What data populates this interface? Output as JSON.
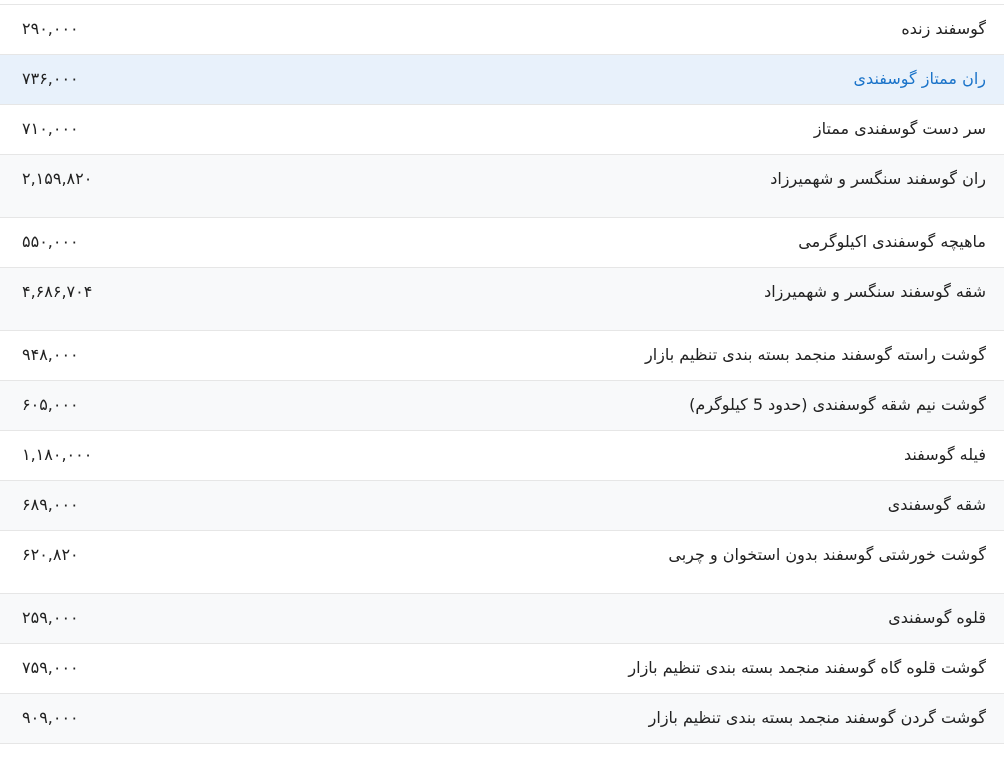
{
  "table": {
    "rows": [
      {
        "name": "گوسفند زنده",
        "price": "۲۹۰,۰۰۰"
      },
      {
        "name": "ران ممتاز گوسفندی",
        "price": "۷۳۶,۰۰۰"
      },
      {
        "name": "سر دست گوسفندی ممتاز",
        "price": "۷۱۰,۰۰۰"
      },
      {
        "name": "ران گوسفند سنگسر و شهمیرزاد",
        "price": "۲,۱۵۹,۸۲۰"
      },
      {
        "name": "ماهیچه گوسفندی اکیلوگرمی",
        "price": "۵۵۰,۰۰۰"
      },
      {
        "name": "شقه گوسفند سنگسر و شهمیرزاد",
        "price": "۴,۶۸۶,۷۰۴"
      },
      {
        "name": "گوشت راسته گوسفند منجمد بسته بندی تنظیم بازار",
        "price": "۹۴۸,۰۰۰"
      },
      {
        "name": "گوشت نیم شقه گوسفندی (حدود 5 کیلوگرم)",
        "price": "۶۰۵,۰۰۰"
      },
      {
        "name": "فیله گوسفند",
        "price": "۱,۱۸۰,۰۰۰"
      },
      {
        "name": "شقه گوسفندی",
        "price": "۶۸۹,۰۰۰"
      },
      {
        "name": "گوشت خورشتی گوسفند بدون استخوان و چربی",
        "price": "۶۲۰,۸۲۰"
      },
      {
        "name": "قلوه گوسفندی",
        "price": "۲۵۹,۰۰۰"
      },
      {
        "name": "گوشت قلوه گاه گوسفند منجمد بسته بندی تنظیم بازار",
        "price": "۷۵۹,۰۰۰"
      },
      {
        "name": "گوشت گردن گوسفند منجمد بسته بندی تنظیم بازار",
        "price": "۹۰۹,۰۰۰"
      }
    ]
  }
}
